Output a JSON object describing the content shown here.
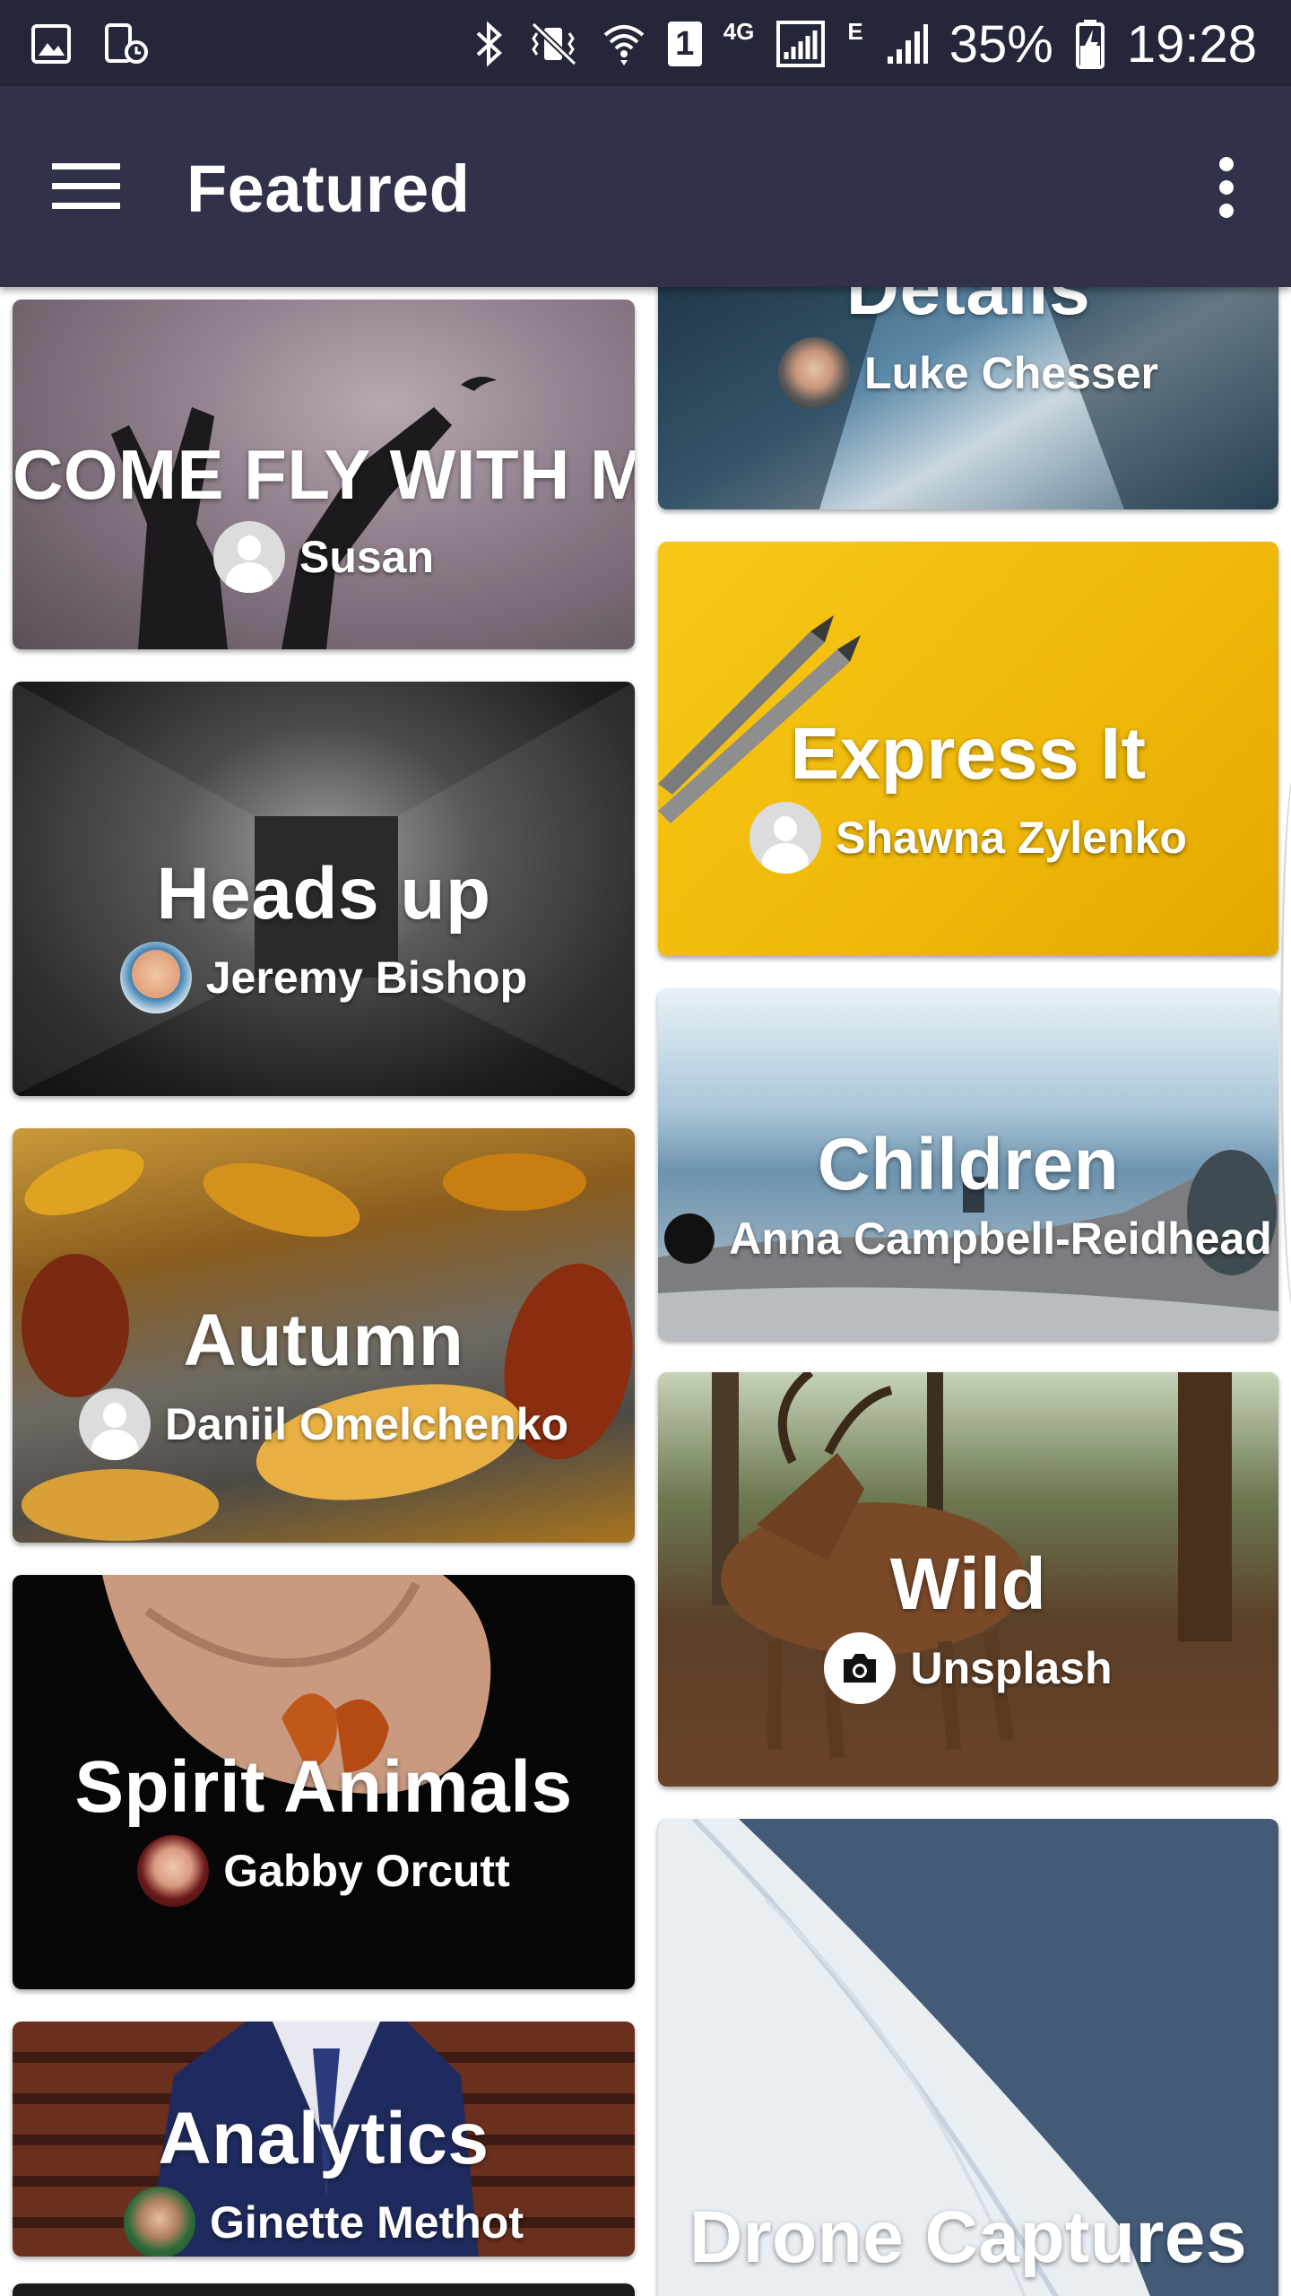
{
  "status_bar": {
    "network_small": "4G",
    "sim_slot": "1",
    "network_e": "E",
    "battery": "35%",
    "time": "19:28"
  },
  "toolbar": {
    "title": "Featured"
  },
  "cards": [
    {
      "title": "COME FLY WITH ME",
      "author": "Susan",
      "avatar": "default"
    },
    {
      "title": "Heads up",
      "author": "Jeremy Bishop",
      "avatar": "photo"
    },
    {
      "title": "Autumn",
      "author": "Daniil Omelchenko",
      "avatar": "default"
    },
    {
      "title": "Spirit Animals",
      "author": "Gabby Orcutt",
      "avatar": "photo"
    },
    {
      "title": "Analytics",
      "author": "Ginette Methot",
      "avatar": "photo"
    },
    {
      "title": "Details",
      "author": "Luke Chesser",
      "avatar": "photo"
    },
    {
      "title": "Express It",
      "author": "Shawna Zylenko",
      "avatar": "default"
    },
    {
      "title": "Children",
      "author": "Anna Campbell-Reidhead",
      "avatar": "dark"
    },
    {
      "title": "Wild",
      "author": "Unsplash",
      "avatar": "camera"
    },
    {
      "title": "Drone Captures",
      "author": "",
      "avatar": ""
    }
  ]
}
